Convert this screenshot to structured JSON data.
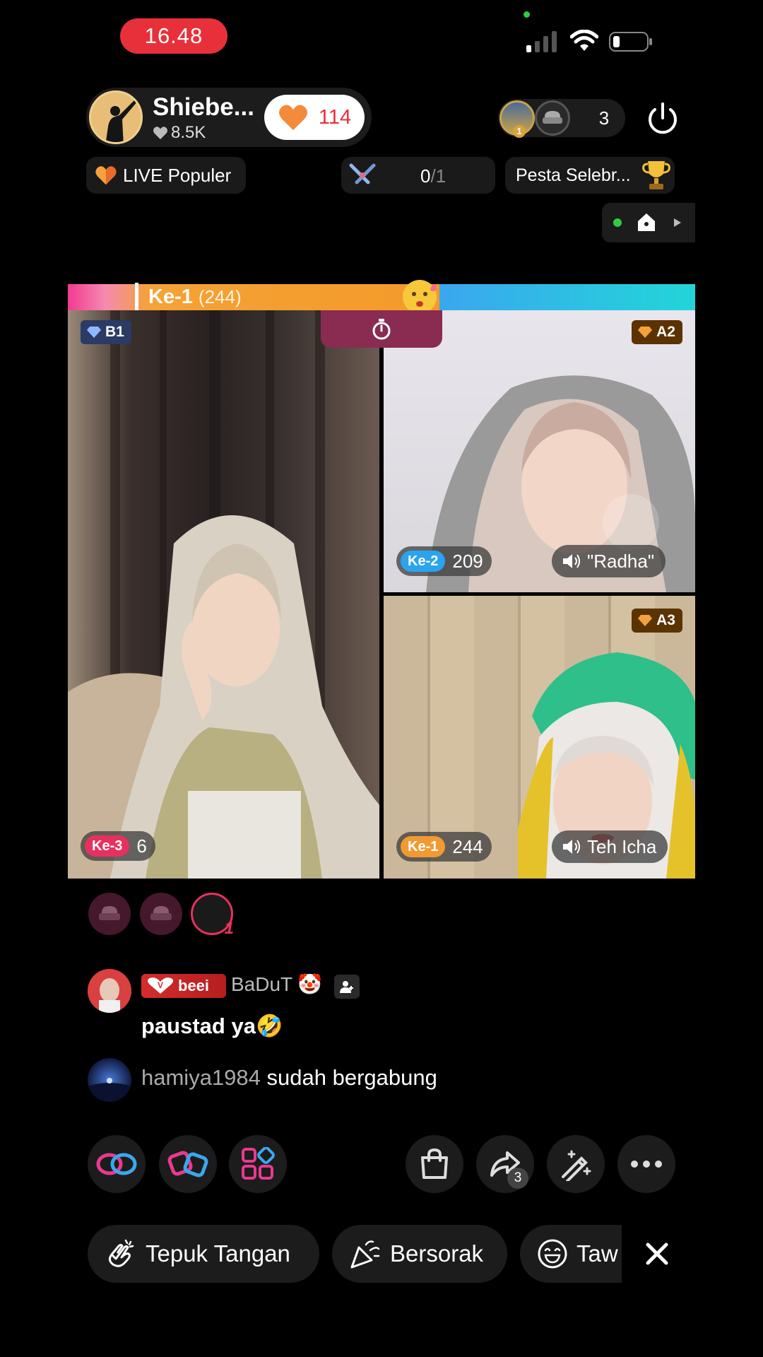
{
  "status": {
    "time": "16.48"
  },
  "host": {
    "name": "Shiebe...",
    "likes": "8.5K",
    "like_count": "114"
  },
  "viewers": {
    "count": "3",
    "top_rank": "1"
  },
  "pills": {
    "live_popular": "LIVE Populer",
    "battle_score": "0",
    "battle_total": "/1",
    "party": "Pesta Selebr..."
  },
  "battle": {
    "leader_label": "Ke-1",
    "leader_score": "(244)",
    "left_share": 0.54
  },
  "players": [
    {
      "badge": "B1",
      "rank": "Ke-3",
      "score": "6",
      "rank_color": "#e8305e"
    },
    {
      "badge": "A2",
      "rank": "Ke-2",
      "score": "209",
      "name": "\"Radha\"",
      "rank_color": "#2aa4ef"
    },
    {
      "badge": "A3",
      "rank": "Ke-1",
      "score": "244",
      "name": "Teh Icha",
      "rank_color": "#f29a32"
    }
  ],
  "seats": {
    "count_badge": "1"
  },
  "comments": [
    {
      "tag": "beei",
      "user": "BaDuT",
      "text": "paustad ya🤣"
    },
    {
      "user": "hamiya1984",
      "text": "sudah bergabung"
    }
  ],
  "toolbar": {
    "share_count": "3"
  },
  "reactions": {
    "clap": "Tepuk Tangan",
    "cheer": "Bersorak",
    "laugh": "Taw"
  },
  "icons": [
    "signal-icon",
    "wifi-icon",
    "battery-icon",
    "heart-icon",
    "power-icon",
    "trophy-icon",
    "timer-icon",
    "diamond-icon",
    "speaker-icon",
    "sofa-icon",
    "bag-icon",
    "share-icon",
    "magic-wand-icon",
    "more-icon",
    "close-icon"
  ],
  "colors": {
    "accent_red": "#e8303a",
    "bar_pink": "#f23a8f",
    "bar_orange": "#f39a2a",
    "bar_blue": "#3aa7ee"
  }
}
